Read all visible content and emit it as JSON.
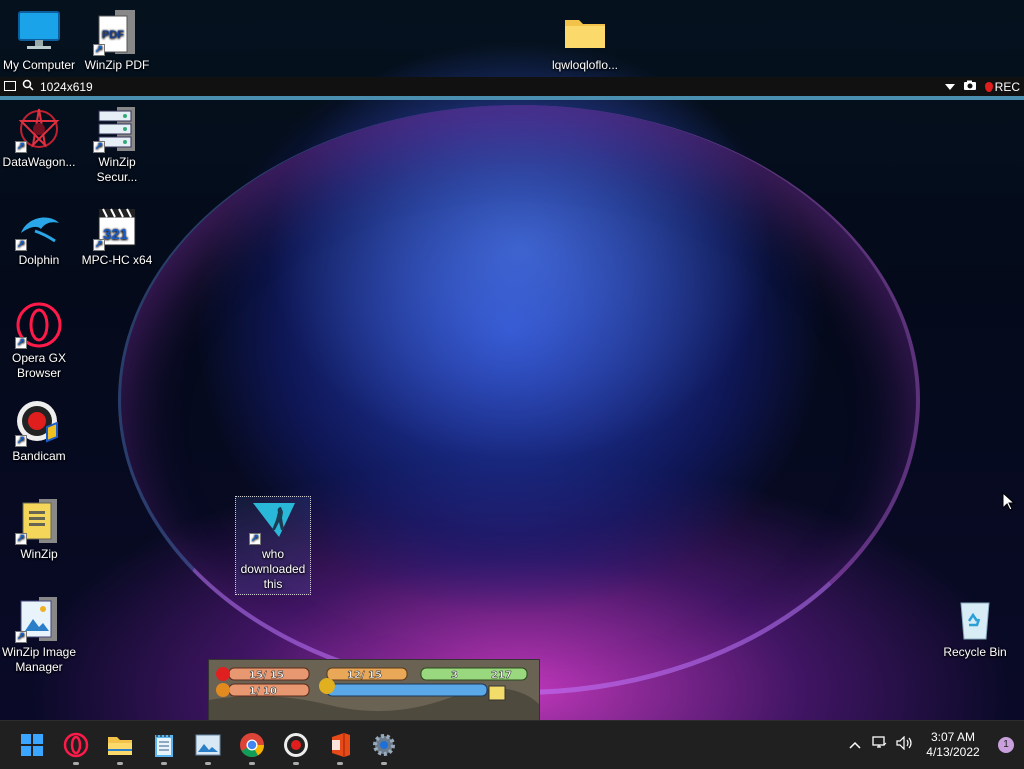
{
  "desktop_icons": {
    "my_computer": "My Computer",
    "winzip_pdf": "WinZip PDF",
    "folder": "lqwloqloflo...",
    "datawagon": "DataWagon...",
    "winzip_secure_1": "WinZip",
    "winzip_secure_2": "Secur...",
    "dolphin": "Dolphin",
    "mpc": "MPC-HC x64",
    "mpc_badge": "321",
    "opera_1": "Opera GX",
    "opera_2": "Browser",
    "bandicam": "Bandicam",
    "winzip": "WinZip",
    "winzip_img_1": "WinZip Image",
    "winzip_img_2": "Manager",
    "selected_1": "who",
    "selected_2": "downloaded",
    "selected_3": "this",
    "recycle": "Recycle Bin",
    "pdf_badge": "PDF"
  },
  "recording_bar": {
    "resolution": "1024x619",
    "rec_label": "REC"
  },
  "game_hud": {
    "hp": "15/ 15",
    "fp": "12/ 15",
    "coins": "3",
    "star_points": "217",
    "partner_hp": "1/ 10"
  },
  "taskbar": {
    "apps": [
      "start-icon",
      "opera-gx-icon",
      "file-explorer-icon",
      "notepad-icon",
      "image-manager-icon",
      "chrome-icon",
      "bandicam-icon",
      "office-icon",
      "settings-icon"
    ],
    "time": "3:07 AM",
    "date": "4/13/2022",
    "notification_count": "1"
  },
  "colors": {
    "taskbar_bg": "#202020",
    "rec_accent": "#e01e1e",
    "recbar_border": "#4a8fb0"
  }
}
